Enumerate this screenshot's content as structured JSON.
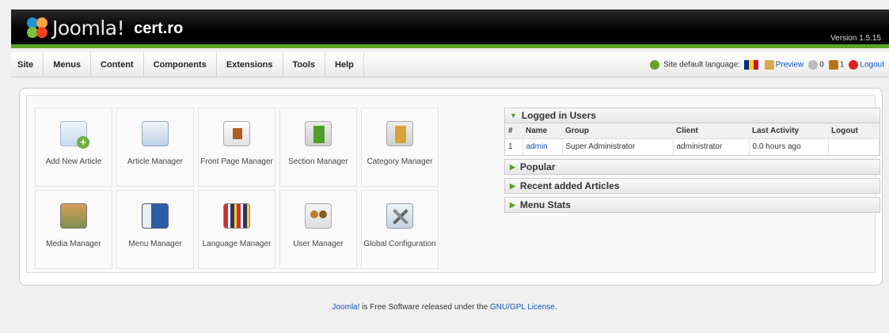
{
  "header": {
    "brand": "Joomla!",
    "site_name": "cert.ro",
    "version": "Version 1.5.15"
  },
  "menu": {
    "items": [
      "Site",
      "Menus",
      "Content",
      "Components",
      "Extensions",
      "Tools",
      "Help"
    ]
  },
  "status": {
    "language_label": "Site default language:",
    "preview": "Preview",
    "messages_count": "0",
    "users_count": "1",
    "logout": "Logout"
  },
  "cpanel": {
    "icons": [
      {
        "label": "Add New Article",
        "icon": "add-article-icon"
      },
      {
        "label": "Article Manager",
        "icon": "article-manager-icon"
      },
      {
        "label": "Front Page Manager",
        "icon": "front-page-icon"
      },
      {
        "label": "Section Manager",
        "icon": "section-icon"
      },
      {
        "label": "Category Manager",
        "icon": "category-icon"
      },
      {
        "label": "Media Manager",
        "icon": "media-icon"
      },
      {
        "label": "Menu Manager",
        "icon": "menu-manager-icon"
      },
      {
        "label": "Language Manager",
        "icon": "language-icon"
      },
      {
        "label": "User Manager",
        "icon": "user-manager-icon"
      },
      {
        "label": "Global Configuration",
        "icon": "config-icon"
      }
    ]
  },
  "modules": {
    "logged_in": {
      "title": "Logged in Users",
      "columns": [
        "#",
        "Name",
        "Group",
        "Client",
        "Last Activity",
        "Logout"
      ],
      "rows": [
        {
          "num": "1",
          "name": "admin",
          "group": "Super Administrator",
          "client": "administrator",
          "last_activity": "0.0 hours ago",
          "logout": ""
        }
      ]
    },
    "popular": "Popular",
    "recent": "Recent added Articles",
    "menu_stats": "Menu Stats"
  },
  "footer": {
    "link1": "Joomla!",
    "text": "is Free Software released under the",
    "link2": "GNU/GPL License",
    "end": "."
  },
  "colors": {
    "accent_green": "#5da423",
    "link_blue": "#0b55c4",
    "header_black": "#000000"
  }
}
